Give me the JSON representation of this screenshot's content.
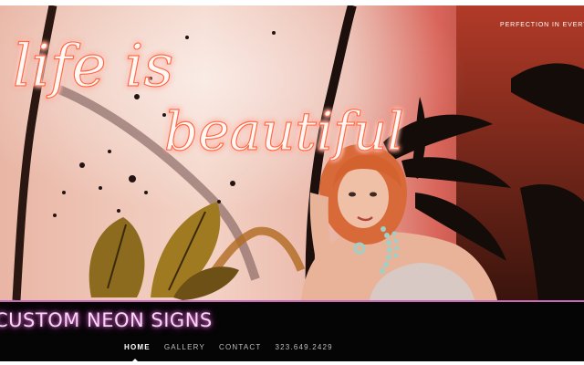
{
  "hero": {
    "tagline": "PERFECTION IN EVERY SIGN",
    "neon_sign": {
      "line1": "life is",
      "line2": "beautiful"
    }
  },
  "brand": {
    "name": "CUSTOM NEON SIGNS"
  },
  "nav": {
    "items": [
      {
        "label": "HOME",
        "active": true
      },
      {
        "label": "GALLERY",
        "active": false
      },
      {
        "label": "CONTACT",
        "active": false
      },
      {
        "label": "323.649.2429",
        "active": false
      }
    ]
  },
  "colors": {
    "neon_sign": "#ffffff",
    "neon_glow": "#ff5a3c",
    "brand_glow": "#e06ad4",
    "accent_line": "#c56bb8",
    "bar": "#050505"
  }
}
